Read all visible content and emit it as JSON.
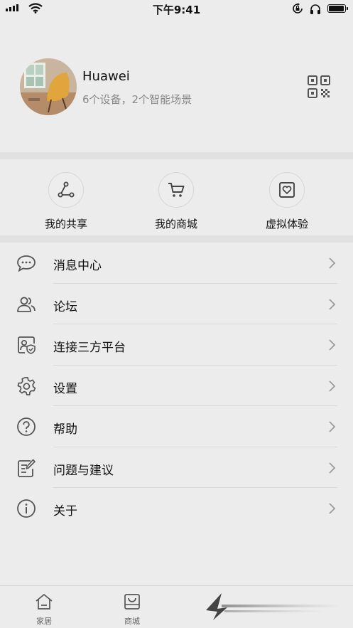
{
  "status_bar": {
    "time": "下午9:41",
    "battery_level": 0.95
  },
  "profile": {
    "name": "Huawei",
    "summary": "6个设备，2个智能场景"
  },
  "quick_actions": [
    {
      "label": "我的共享",
      "icon": "share-icon"
    },
    {
      "label": "我的商城",
      "icon": "cart-icon"
    },
    {
      "label": "虚拟体验",
      "icon": "virtual-experience-icon"
    }
  ],
  "menu": [
    {
      "label": "消息中心",
      "icon": "message-icon"
    },
    {
      "label": "论坛",
      "icon": "forum-users-icon"
    },
    {
      "label": "连接三方平台",
      "icon": "third-party-platform-icon"
    },
    {
      "label": "设置",
      "icon": "gear-icon"
    },
    {
      "label": "帮助",
      "icon": "help-icon"
    },
    {
      "label": "问题与建议",
      "icon": "feedback-icon"
    },
    {
      "label": "关于",
      "icon": "info-icon"
    }
  ],
  "tab_bar": {
    "tabs": [
      {
        "label": "家居",
        "icon": "home-icon"
      },
      {
        "label": "商城",
        "icon": "store-bag-icon"
      }
    ]
  },
  "colors": {
    "background": "#ececec",
    "divider": "#e1e1e1",
    "icon_gray": "#555555",
    "secondary_text": "#888888"
  }
}
